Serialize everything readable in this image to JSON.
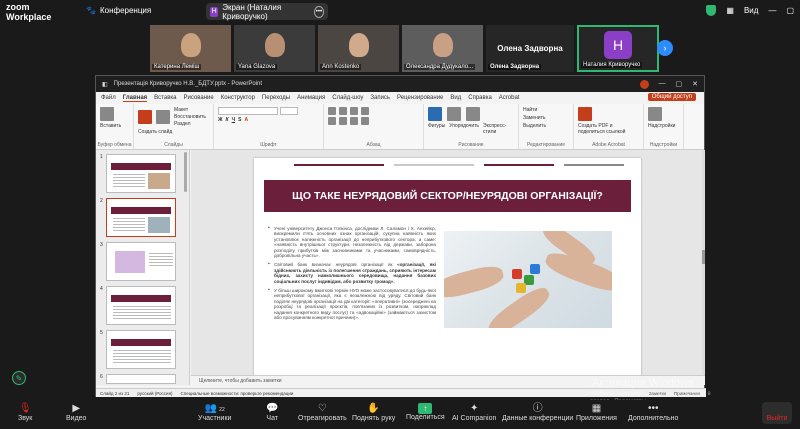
{
  "zoom": {
    "logo_line1": "zoom",
    "logo_line2": "Workplace",
    "conference_label": "Конференция",
    "screen_share_label": "Экран (Наталия Криворучко)",
    "screen_share_initial": "H",
    "view_label": "Вид"
  },
  "participants": [
    {
      "name": "Катерина Леміш"
    },
    {
      "name": "Yana Glazova"
    },
    {
      "name": "Ann Kostenko"
    },
    {
      "name": "Олександра Дудукало..."
    },
    {
      "name": "Олена Задворна",
      "display": "Олена Задворна"
    },
    {
      "name": "Наталия Криворучко",
      "initial": "H"
    }
  ],
  "powerpoint": {
    "file_title": "Презентація Криворучко Н.В._БДТУ.pptx - PowerPoint",
    "tabs": [
      "Файл",
      "Главная",
      "Вставка",
      "Рисование",
      "Конструктор",
      "Переходы",
      "Анимация",
      "Слайд-шоу",
      "Запись",
      "Рецензирование",
      "Вид",
      "Справка",
      "Acrobat"
    ],
    "share_button": "Общий доступ",
    "ribbon": {
      "paste": "Вставить",
      "clipboard_group": "Буфер обмена",
      "new_slide": "Создать слайд",
      "reuse": "Повторное использование слайдов",
      "layout": "Макет",
      "reset": "Восстановить",
      "section": "Раздел",
      "slides_group": "Слайды",
      "font_group": "Шрифт",
      "paragraph_group": "Абзац",
      "shapes": "Фигуры",
      "arrange": "Упорядочить",
      "quick_styles": "Экспресс-стили",
      "drawing_group": "Рисование",
      "find": "Найти",
      "replace": "Заменить",
      "select": "Выделить",
      "editing_group": "Редактирование",
      "create_pdf": "Создать PDF и поделиться ссылкой",
      "acrobat_group": "Adobe Acrobat",
      "addins": "Надстройки",
      "addins_group": "Надстройки"
    },
    "slide_numbers": [
      "1",
      "2",
      "3",
      "4",
      "5",
      "6"
    ],
    "slide": {
      "title": "ЩО ТАКЕ НЕУРЯДОВИЙ СЕКТОР/НЕУРЯДОВІ ОРГАНІЗАЦІЇ?",
      "para1": "Учені університету Джонса Гопкінса, дослідники Л. Саламон і Х. Анхейєр, виокремили п'ять основних ознак організацій, сукупна наявність яких установлює належність організації до неприбуткового сектора, а саме: «наявність внутрішньої структури, незалежність від держави, заборона розподілу прибутків між засновниками та учасниками, самоврядність, добровільна участь».",
      "para2_a": "Світовий банк визначає неурядові організації як ",
      "para2_b": "«організації, які здійснюють діяльність із полегшення страждань, сприяють інтересам бідних, захисту навколишнього середовища, надання базових соціальних послуг індивідам, або розвитку громад».",
      "para3": "У більш широкому вжиткові термін НУО може застосовуватися до будь-якої неприбуткової організації, яка є незалежною від уряду. Світовий банк поділяє неурядові організації на дві категорії: «оперативні» (зосереджені на розробці та реалізації проєктів, пов'язаних із розвитком, наприклад надання конкретного виду послуг) та «адвокаційні» (займаються захистом або просуванням конкретної причини)».",
      "band_colors": [
        "#6b1f3a",
        "#c9c9c9",
        "#6b1f3a",
        "#8a8a8a"
      ]
    },
    "notes_placeholder": "Щелкните, чтобы добавить заметки",
    "status": {
      "slide_count": "Слайд 2 из 21",
      "language": "русский (Россия)",
      "accessibility": "Специальные возможности: проверьте рекомендации",
      "notes": "Заметки",
      "comments": "Примечания"
    }
  },
  "windows_activation": {
    "title": "Активация Windows",
    "subtitle": "Чтобы активировать Windows, перейдите в раздел «Параметры»."
  },
  "toolbar": {
    "audio": "Звук",
    "video": "Видео",
    "participants": "Участники",
    "participants_count": "22",
    "chat": "Чат",
    "react": "Отреагировать",
    "raise_hand": "Поднять руку",
    "share": "Поделиться",
    "ai": "AI Companion",
    "info": "Данные конференции",
    "apps": "Приложения",
    "more": "Дополнительно",
    "leave": "Выйти"
  },
  "colors": {
    "accent_maroon": "#6b1f3a",
    "zoom_green": "#2eb872",
    "zoom_blue": "#2d8cff",
    "office_red": "#c43e1c",
    "avatar_purple": "#8b3fc7"
  }
}
